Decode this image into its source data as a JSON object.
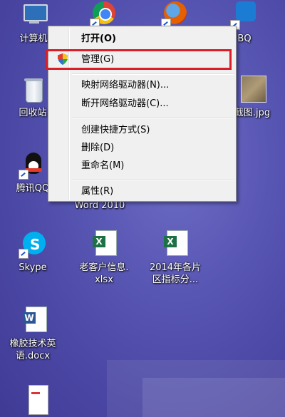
{
  "desktop": {
    "icons": [
      {
        "label": "计算机"
      },
      {
        "label": ""
      },
      {
        "label": ""
      },
      {
        "label": "BQ"
      },
      {
        "label": "回收站"
      },
      {
        "label": "截图.jpg"
      },
      {
        "label": "腾讯QQ"
      },
      {
        "label": "Word 2010"
      },
      {
        "label": "Skype"
      },
      {
        "label": "老客户信息.xlsx"
      },
      {
        "label": "2014年各片区指标分..."
      },
      {
        "label": "橡胶技术英语.docx"
      }
    ]
  },
  "context_menu": {
    "items": [
      {
        "label": "打开(O)"
      },
      {
        "label": "管理(G)"
      },
      {
        "label": "映射网络驱动器(N)..."
      },
      {
        "label": "断开网络驱动器(C)..."
      },
      {
        "label": "创建快捷方式(S)"
      },
      {
        "label": "删除(D)"
      },
      {
        "label": "重命名(M)"
      },
      {
        "label": "属性(R)"
      }
    ]
  },
  "colors": {
    "highlight_border": "#d91e2a",
    "menu_bg": "#f0f0f0"
  }
}
